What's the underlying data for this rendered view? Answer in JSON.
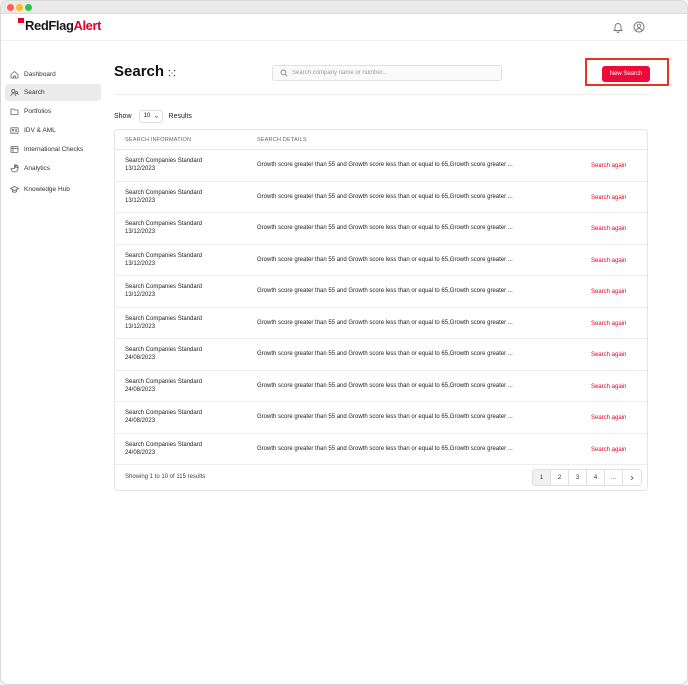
{
  "app": {
    "logo_main": "RedFlag",
    "logo_accent": "Alert"
  },
  "header": {
    "icons": [
      "bell-icon",
      "user-circle-icon"
    ]
  },
  "sidebar": {
    "items": [
      {
        "label": "Dashboard",
        "icon": "home-icon"
      },
      {
        "label": "Search",
        "icon": "users-search-icon",
        "active": true
      },
      {
        "label": "Portfolios",
        "icon": "folder-icon"
      },
      {
        "label": "IDV & AML",
        "icon": "id-card-icon"
      },
      {
        "label": "International Checks",
        "icon": "globe-icon"
      },
      {
        "label": "Analytics",
        "icon": "chart-icon"
      },
      {
        "label": "Knowledge Hub",
        "icon": "graduation-cap-icon"
      }
    ]
  },
  "main": {
    "title": "Search",
    "search_placeholder": "Search company name or number...",
    "new_search_label": "New Search",
    "show_label": "Show",
    "page_size": "10",
    "results_label": "Results",
    "table": {
      "headers": {
        "info": "SEARCH INFORMATION",
        "details": "SEARCH DETAILS"
      },
      "rows": [
        {
          "name": "Search Companies Standard",
          "date": "13/12/2023",
          "details": "Growth score greater than 55 and Growth score less than or equal to 65,Growth score greater ...",
          "action": "Search again"
        },
        {
          "name": "Search Companies Standard",
          "date": "13/12/2023",
          "details": "Growth score greater than 55 and Growth score less than or equal to 65,Growth score greater ...",
          "action": "Search again"
        },
        {
          "name": "Search Companies Standard",
          "date": "13/12/2023",
          "details": "Growth score greater than 55 and Growth score less than or equal to 65,Growth score greater ...",
          "action": "Search again"
        },
        {
          "name": "Search Companies Standard",
          "date": "13/12/2023",
          "details": "Growth score greater than 55 and Growth score less than or equal to 65,Growth score greater ...",
          "action": "Search again"
        },
        {
          "name": "Search Companies Standard",
          "date": "13/12/2023",
          "details": "Growth score greater than 55 and Growth score less than or equal to 65,Growth score greater ...",
          "action": "Search again"
        },
        {
          "name": "Search Companies Standard",
          "date": "13/12/2023",
          "details": "Growth score greater than 55 and Growth score less than or equal to 65,Growth score greater ...",
          "action": "Search again"
        },
        {
          "name": "Search Companies Standard",
          "date": "24/08/2023",
          "details": "Growth score greater than 55 and Growth score less than or equal to 65,Growth score greater ...",
          "action": "Search again"
        },
        {
          "name": "Search Companies Standard",
          "date": "24/08/2023",
          "details": "Growth score greater than 55 and Growth score less than or equal to 65,Growth score greater ...",
          "action": "Search again"
        },
        {
          "name": "Search Companies Standard",
          "date": "24/08/2023",
          "details": "Growth score greater than 55 and Growth score less than or equal to 65,Growth score greater ...",
          "action": "Search again"
        },
        {
          "name": "Search Companies Standard",
          "date": "24/08/2023",
          "details": "Growth score greater than 55 and Growth score less than or equal to 65,Growth score greater ...",
          "action": "Search again"
        }
      ],
      "footer_text": "Showing 1 to 10 of 115 results",
      "pages": [
        "1",
        "2",
        "3",
        "4",
        "..."
      ],
      "current_page": "1"
    }
  },
  "colors": {
    "brand_red": "#e4002b",
    "button_red": "#ee0a38",
    "highlight_frame": "#e4361e"
  }
}
